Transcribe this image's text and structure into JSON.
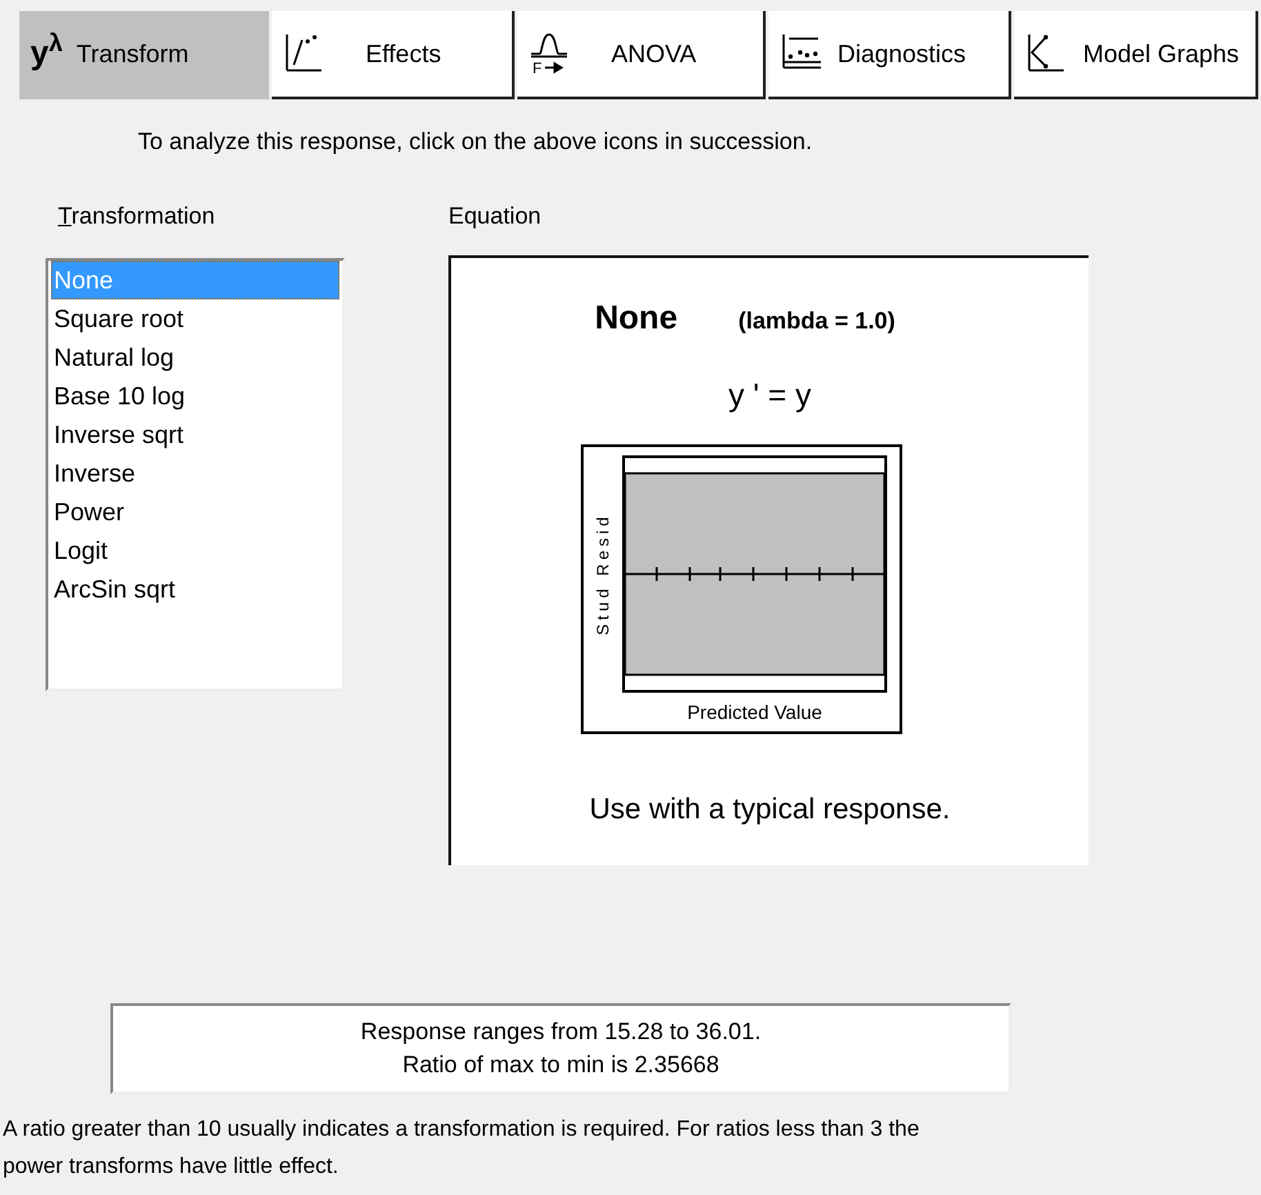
{
  "tabs": [
    {
      "label": "Transform",
      "kind": "power",
      "selected": true
    },
    {
      "label": "Effects",
      "kind": "effects",
      "selected": false
    },
    {
      "label": "ANOVA",
      "kind": "anova",
      "icon_label": "F",
      "selected": false
    },
    {
      "label": "Diagnostics",
      "kind": "diagnostics",
      "selected": false
    },
    {
      "label": "Model Graphs",
      "kind": "graphs",
      "selected": false
    }
  ],
  "power_symbol": "y$^{λ}$",
  "instruction": "To analyze this response, click on the above icons in succession.",
  "transformation": {
    "label": "Transformation",
    "first_letter_underlined": true,
    "items": [
      {
        "label": "None",
        "selected": true
      },
      {
        "label": "Square root",
        "selected": false
      },
      {
        "label": "Natural log",
        "selected": false
      },
      {
        "label": "Base 10 log",
        "selected": false
      },
      {
        "label": "Inverse sqrt",
        "selected": false
      },
      {
        "label": "Inverse",
        "selected": false
      },
      {
        "label": "Power",
        "selected": false
      },
      {
        "label": "Logit",
        "selected": false
      },
      {
        "label": "ArcSin sqrt",
        "selected": false
      }
    ]
  },
  "equation": {
    "label": "Equation",
    "name": "None",
    "lambda": "(lambda = 1.0)",
    "formula": "y ' = y",
    "plot": {
      "ylabel": "Stud Resid",
      "xlabel": "Predicted Value"
    },
    "advice": "Use with a typical response."
  },
  "range_box": [
    "Response ranges from 15.28 to 36.01.",
    "Ratio of max to min is 2.35668"
  ],
  "footnote": "A ratio greater than 10 usually indicates a transformation is required.  For ratios less than 3 the power transforms have little effect."
}
